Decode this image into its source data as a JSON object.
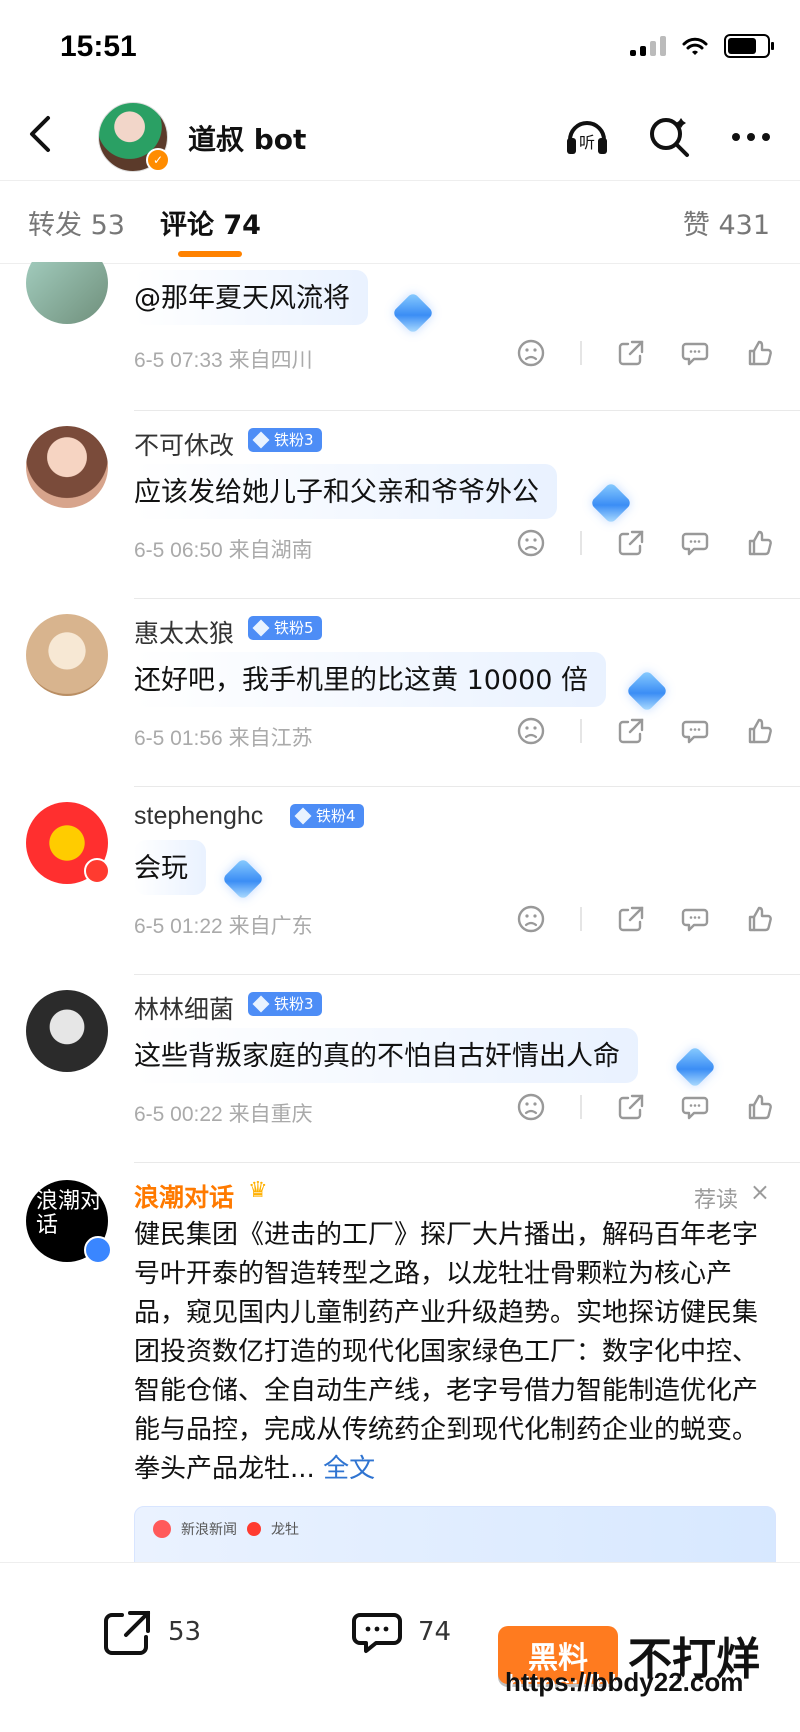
{
  "status_bar": {
    "time": "15:51",
    "icons": [
      "signal-icon",
      "wifi-icon",
      "battery-icon"
    ]
  },
  "top_bar": {
    "title": "道叔 bot",
    "listen_label": "听",
    "icons": [
      "back-icon",
      "listen-icon",
      "search-icon",
      "more-icon"
    ]
  },
  "tabs": {
    "repost": "转发 53",
    "comments": "评论 74",
    "likes": "赞 431"
  },
  "comments": [
    {
      "name": "",
      "badge": "",
      "text": "@那年夏天风流将",
      "meta": "6-5 07:33  来自四川"
    },
    {
      "name": "不可休改",
      "badge": "铁粉3",
      "text": "应该发给她儿子和父亲和爷爷外公",
      "meta": "6-5 06:50  来自湖南"
    },
    {
      "name": "惠太太狼",
      "badge": "铁粉5",
      "text": "还好吧，我手机里的比这黄 10000 倍",
      "meta": "6-5 01:56  来自江苏"
    },
    {
      "name": "stephenghc",
      "badge": "铁粉4",
      "text": "会玩",
      "meta": "6-5 01:22  来自广东"
    },
    {
      "name": "林林细菌",
      "badge": "铁粉3",
      "text": "这些背叛家庭的真的不怕自古奸情出人命",
      "meta": "6-5 00:22  来自重庆"
    }
  ],
  "ad": {
    "avatar_text": "浪潮对话",
    "name": "浪潮对话",
    "tag": "荐读",
    "close": "×",
    "body": "健民集团《进击的工厂》探厂大片播出，解码百年老字号叶开泰的智造转型之路，以龙牡壮骨颗粒为核心产品，窥见国内儿童制药产业升级趋势。实地探访健民集团投资数亿打造的现代化国家绿色工厂：数字化中控、智能仓储、全自动生产线，老字号借力智能制造优化产能与品控，完成从传统药企到现代化制药企业的蜕变。拳头产品龙牡...",
    "full": "全文",
    "image_labels": [
      "新浪新闻",
      "龙牡"
    ]
  },
  "bottom_bar": {
    "repost_count": "53",
    "comment_count": "74"
  },
  "watermark": {
    "badge": "黑料",
    "text": "不打烊",
    "url": "https://bbdy22.com"
  }
}
